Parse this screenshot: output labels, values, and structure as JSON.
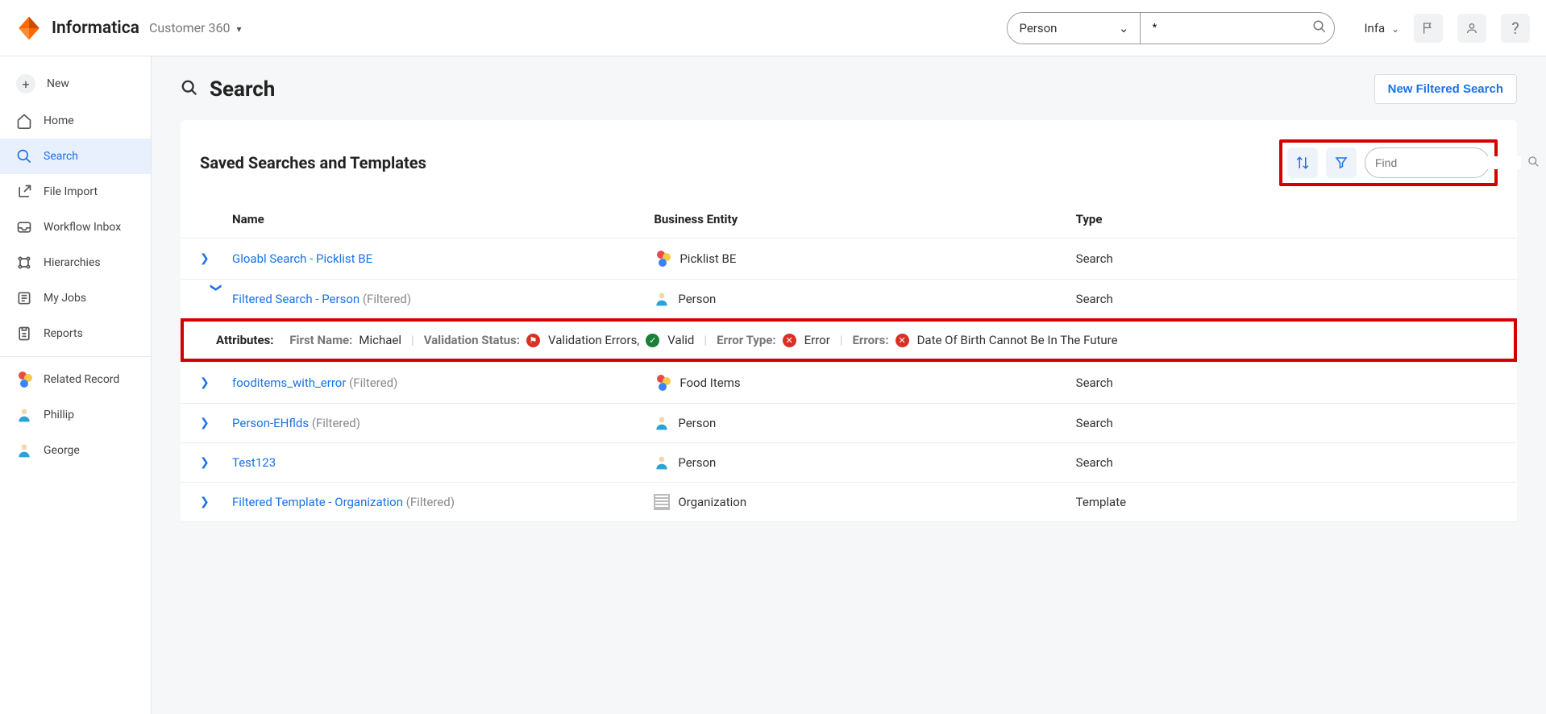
{
  "header": {
    "brand": "Informatica",
    "app": "Customer 360",
    "entity_selected": "Person",
    "search_value": "*",
    "user": "Infa"
  },
  "sidebar": {
    "new": "New",
    "items": [
      {
        "label": "Home"
      },
      {
        "label": "Search"
      },
      {
        "label": "File Import"
      },
      {
        "label": "Workflow Inbox"
      },
      {
        "label": "Hierarchies"
      },
      {
        "label": "My Jobs"
      },
      {
        "label": "Reports"
      }
    ],
    "recents": [
      {
        "label": "Related Record"
      },
      {
        "label": "Phillip"
      },
      {
        "label": "George"
      }
    ]
  },
  "page": {
    "title": "Search",
    "new_search_btn": "New Filtered Search"
  },
  "panel": {
    "title": "Saved Searches and Templates",
    "find_placeholder": "Find",
    "columns": {
      "name": "Name",
      "be": "Business Entity",
      "type": "Type"
    },
    "rows": [
      {
        "name": "Gloabl Search - Picklist BE",
        "filtered": "",
        "be": "Picklist BE",
        "be_icon": "multi",
        "type": "Search",
        "expanded": false
      },
      {
        "name": "Filtered Search - Person",
        "filtered": "(Filtered)",
        "be": "Person",
        "be_icon": "person",
        "type": "Search",
        "expanded": true
      },
      {
        "name": "fooditems_with_error",
        "filtered": "(Filtered)",
        "be": "Food Items",
        "be_icon": "multi",
        "type": "Search",
        "expanded": false
      },
      {
        "name": "Person-EHflds",
        "filtered": "(Filtered)",
        "be": "Person",
        "be_icon": "person",
        "type": "Search",
        "expanded": false
      },
      {
        "name": "Test123",
        "filtered": "",
        "be": "Person",
        "be_icon": "person",
        "type": "Search",
        "expanded": false
      },
      {
        "name": "Filtered Template - Organization",
        "filtered": "(Filtered)",
        "be": "Organization",
        "be_icon": "building",
        "type": "Template",
        "expanded": false
      }
    ],
    "detail": {
      "attributes_label": "Attributes:",
      "first_name_key": "First Name:",
      "first_name_val": "Michael",
      "validation_status_key": "Validation Status:",
      "validation_errors": "Validation Errors,",
      "valid": "Valid",
      "error_type_key": "Error Type:",
      "error_type_val": "Error",
      "errors_key": "Errors:",
      "errors_val": "Date Of Birth Cannot Be In The Future"
    }
  }
}
